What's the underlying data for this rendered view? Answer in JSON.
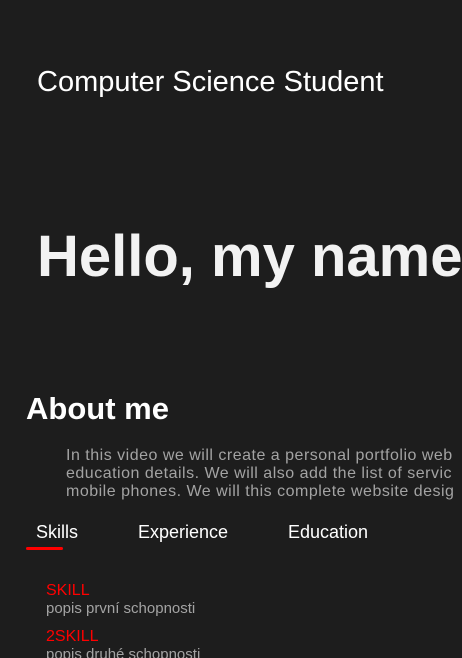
{
  "header": {
    "subtitle": "Computer Science Student",
    "hero_title": "Hello, my name"
  },
  "about": {
    "heading": "About me",
    "lines": [
      "In this video we will create a personal portfolio web",
      "education details. We will also add the list of servic",
      "mobile phones. We will this complete website desig"
    ]
  },
  "tabs": [
    {
      "label": "Skills",
      "active": true
    },
    {
      "label": "Experience",
      "active": false
    },
    {
      "label": "Education",
      "active": false
    }
  ],
  "skills": [
    {
      "name": "SKILL",
      "description": "popis první schopnosti"
    },
    {
      "name": "2SKILL",
      "description": "popis druhé schopnosti"
    }
  ],
  "colors": {
    "background": "#1d1d1d",
    "accent": "#ff0000",
    "muted_text": "#a3a3a3"
  }
}
